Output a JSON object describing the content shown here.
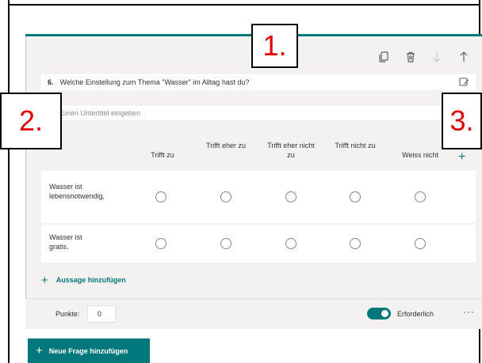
{
  "question": {
    "number": "6.",
    "text": "Welche Einstellung zum Thema \"Wasser\" im Alltag hast du?",
    "subtitle_placeholder": "Einen Untertitel eingeben"
  },
  "toolbar": {
    "icons": [
      "copy-icon",
      "delete-icon",
      "move-down-icon",
      "move-up-icon"
    ]
  },
  "likert": {
    "columns": [
      "Trifft zu",
      "Trifft eher zu",
      "Trifft eher nicht zu",
      "Trifft nicht zu",
      "Weiss nicht"
    ],
    "statements": [
      "Wasser ist lebensnotwendig,",
      "Wasser ist gratis."
    ]
  },
  "add_statement_label": "Aussage hinzufügen",
  "points": {
    "label": "Punkte:",
    "value": "0"
  },
  "required": {
    "label": "Erforderlich",
    "on": true
  },
  "more_label": "···",
  "new_question_button": "Neue Frage hinzufügen",
  "callouts": [
    "1.",
    "2.",
    "3."
  ],
  "colors": {
    "accent": "#03787c",
    "callout_text": "#e00000"
  }
}
